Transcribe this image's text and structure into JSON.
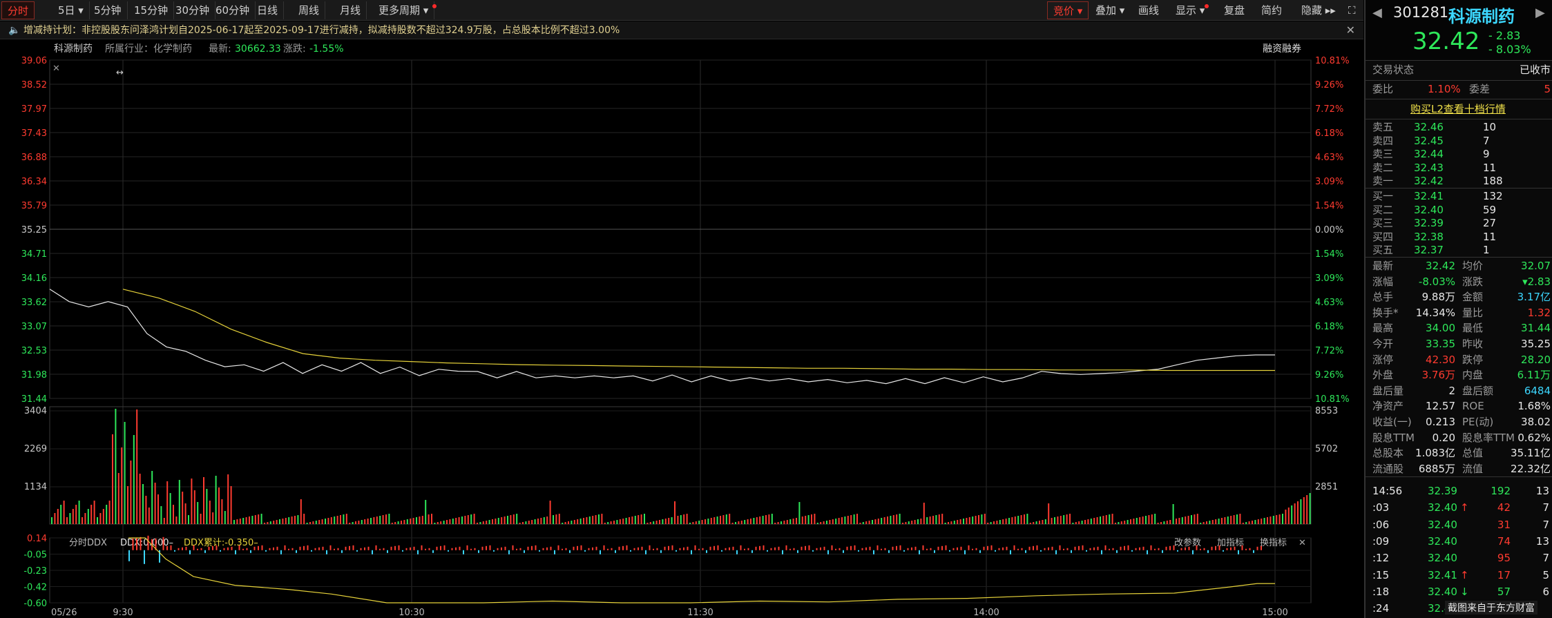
{
  "toolbar": {
    "left_tabs": [
      "分时",
      "5日 ▾",
      "5分钟",
      "15分钟",
      "30分钟",
      "60分钟",
      "日线",
      "周线",
      "月线",
      "更多周期 ▾"
    ],
    "right_tabs": [
      "竞价 ▾",
      "叠加 ▾",
      "画线",
      "显示 ▾",
      "复盘",
      "简约",
      "隐藏 ▸▸"
    ]
  },
  "notice": {
    "text": "增减持计划：非控股股东问泽鸿计划自2025-06-17起至2025-09-17进行减持，拟减持股数不超过324.9万股，占总股本比例不超过3.00%"
  },
  "chart_header": {
    "name": "科源制药",
    "industry": "所属行业：化学制药",
    "latest_label": "最新:",
    "latest_value": "30662.33",
    "change_label": "涨跌:",
    "change_value": "-1.55%",
    "margin_label": "融资融券"
  },
  "chart_data": {
    "type": "line",
    "price_ticks": [
      "39.06",
      "38.52",
      "37.97",
      "37.43",
      "36.88",
      "36.34",
      "35.79",
      "35.25",
      "34.71",
      "34.16",
      "33.62",
      "33.07",
      "32.53",
      "31.98",
      "31.44"
    ],
    "pct_ticks": [
      "10.81%",
      "9.26%",
      "7.72%",
      "6.18%",
      "4.63%",
      "3.09%",
      "1.54%",
      "0.00%",
      "1.54%",
      "3.09%",
      "4.63%",
      "6.18%",
      "7.72%",
      "9.26%",
      "10.81%"
    ],
    "volume_ticks_left": [
      "3404",
      "2269",
      "1134"
    ],
    "volume_ticks_right": [
      "8553",
      "5702",
      "2851"
    ],
    "ddx_ticks": [
      "0.14",
      "-0.05",
      "-0.23",
      "-0.42",
      "-0.60"
    ],
    "time_ticks": [
      "05/26",
      "9:30",
      "10:30",
      "11:30",
      "14:00",
      "15:00"
    ],
    "ylim": [
      31.44,
      39.06
    ],
    "prev_close": 35.25,
    "price_series": [
      33.9,
      33.62,
      33.5,
      33.62,
      33.5,
      32.9,
      32.6,
      32.5,
      32.3,
      32.2,
      32.15,
      32.1,
      32.2,
      32.05,
      32.15,
      32.1,
      32.2,
      32.05,
      32.1,
      32.0,
      32.05,
      32.1,
      32.0,
      31.95,
      32.0,
      31.95,
      31.9,
      31.95,
      31.9,
      31.95,
      31.9,
      31.88,
      31.92,
      31.86,
      31.9,
      31.88,
      31.86,
      31.88,
      31.84,
      31.86,
      31.82,
      31.84,
      31.8,
      31.82,
      31.84,
      31.82,
      31.86,
      31.84,
      31.88,
      31.86,
      31.9,
      32.05,
      32.0,
      31.98,
      32.0,
      32.02,
      32.06,
      32.1,
      32.2,
      32.3,
      32.35,
      32.4,
      32.42,
      32.42
    ],
    "avg_series": [
      33.9,
      33.7,
      33.4,
      33.0,
      32.7,
      32.45,
      32.35,
      32.3,
      32.27,
      32.24,
      32.22,
      32.2,
      32.19,
      32.18,
      32.17,
      32.16,
      32.15,
      32.14,
      32.13,
      32.12,
      32.12,
      32.11,
      32.1,
      32.1,
      32.09,
      32.09,
      32.08,
      32.08,
      32.08,
      32.07,
      32.07,
      32.07,
      32.07
    ],
    "ddx_label": "分时DDX",
    "ddx_value": "DDX:0.000–",
    "ddx_cum": "DDX累计:-0.350–",
    "ddx_tools": [
      "改参数",
      "加指标",
      "换指标"
    ]
  },
  "quote": {
    "code": "301281",
    "name": "科源制药",
    "price": "32.42",
    "change": "- 2.83",
    "change_pct": "- 8.03%",
    "status_label": "交易状态",
    "status_value": "已收市",
    "weibi_label": "委比",
    "weibi_value": "1.10%",
    "weicha_label": "委差",
    "weicha_value": "5",
    "l2_link": "购买L2查看十档行情"
  },
  "asks": [
    {
      "label": "卖五",
      "price": "32.46",
      "vol": "10"
    },
    {
      "label": "卖四",
      "price": "32.45",
      "vol": "7"
    },
    {
      "label": "卖三",
      "price": "32.44",
      "vol": "9"
    },
    {
      "label": "卖二",
      "price": "32.43",
      "vol": "11"
    },
    {
      "label": "卖一",
      "price": "32.42",
      "vol": "188"
    }
  ],
  "bids": [
    {
      "label": "买一",
      "price": "32.41",
      "vol": "132"
    },
    {
      "label": "买二",
      "price": "32.40",
      "vol": "59"
    },
    {
      "label": "买三",
      "price": "32.39",
      "vol": "27"
    },
    {
      "label": "买四",
      "price": "32.38",
      "vol": "11"
    },
    {
      "label": "买五",
      "price": "32.37",
      "vol": "1"
    }
  ],
  "stats": [
    {
      "l1": "最新",
      "v1": "32.42",
      "c1": "green",
      "l2": "均价",
      "v2": "32.07",
      "c2": "green"
    },
    {
      "l1": "涨幅",
      "v1": "-8.03%",
      "c1": "green",
      "l2": "涨跌",
      "v2": "▾2.83",
      "c2": "green"
    },
    {
      "l1": "总手",
      "v1": "9.88万",
      "c1": "white",
      "l2": "金额",
      "v2": "3.17亿",
      "c2": "cyan"
    },
    {
      "l1": "换手*",
      "v1": "14.34%",
      "c1": "white",
      "l2": "量比",
      "v2": "1.32",
      "c2": "red"
    },
    {
      "l1": "最高",
      "v1": "34.00",
      "c1": "green",
      "l2": "最低",
      "v2": "31.44",
      "c2": "green"
    },
    {
      "l1": "今开",
      "v1": "33.35",
      "c1": "green",
      "l2": "昨收",
      "v2": "35.25",
      "c2": "white"
    },
    {
      "l1": "涨停",
      "v1": "42.30",
      "c1": "red",
      "l2": "跌停",
      "v2": "28.20",
      "c2": "green"
    },
    {
      "l1": "外盘",
      "v1": "3.76万",
      "c1": "red",
      "l2": "内盘",
      "v2": "6.11万",
      "c2": "green"
    },
    {
      "l1": "盘后量",
      "v1": "2",
      "c1": "white",
      "l2": "盘后额",
      "v2": "6484",
      "c2": "cyan"
    },
    {
      "l1": "净资产",
      "v1": "12.57",
      "c1": "white",
      "l2": "ROE",
      "v2": "1.68%",
      "c2": "white"
    },
    {
      "l1": "收益(一)",
      "v1": "0.213",
      "c1": "white",
      "l2": "PE(动)",
      "v2": "38.02",
      "c2": "white"
    },
    {
      "l1": "股息TTM",
      "v1": "0.20",
      "c1": "white",
      "l2": "股息率TTM",
      "v2": "0.62%",
      "c2": "white"
    },
    {
      "l1": "总股本",
      "v1": "1.083亿",
      "c1": "white",
      "l2": "总值",
      "v2": "35.11亿",
      "c2": "white"
    },
    {
      "l1": "流通股",
      "v1": "6885万",
      "c1": "white",
      "l2": "流值",
      "v2": "22.32亿",
      "c2": "white"
    }
  ],
  "ticks": [
    {
      "time": "14:56",
      "price": "32.39",
      "vol": "192",
      "n": "13",
      "arrow": "",
      "pc": "green",
      "vc": "green"
    },
    {
      "time": ":03",
      "price": "32.40",
      "vol": "42",
      "n": "7",
      "arrow": "↑",
      "pc": "green",
      "vc": "red"
    },
    {
      "time": ":06",
      "price": "32.40",
      "vol": "31",
      "n": "7",
      "arrow": "",
      "pc": "green",
      "vc": "red"
    },
    {
      "time": ":09",
      "price": "32.40",
      "vol": "74",
      "n": "13",
      "arrow": "",
      "pc": "green",
      "vc": "red"
    },
    {
      "time": ":12",
      "price": "32.40",
      "vol": "95",
      "n": "7",
      "arrow": "",
      "pc": "green",
      "vc": "red"
    },
    {
      "time": ":15",
      "price": "32.41",
      "vol": "17",
      "n": "5",
      "arrow": "↑",
      "pc": "green",
      "vc": "red"
    },
    {
      "time": ":18",
      "price": "32.40",
      "vol": "57",
      "n": "6",
      "arrow": "↓",
      "pc": "green",
      "vc": "green"
    },
    {
      "time": ":24",
      "price": "32.42",
      "vol": "",
      "n": "",
      "arrow": "",
      "pc": "green",
      "vc": "green"
    }
  ],
  "watermark": "截图来自于东方财富"
}
